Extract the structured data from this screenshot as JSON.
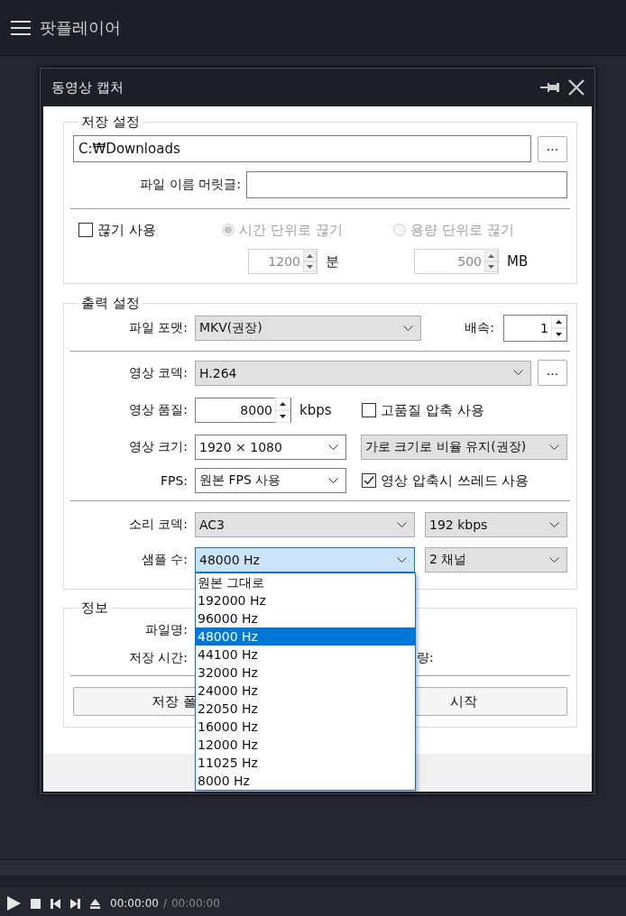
{
  "app": {
    "title": "팟플레이어"
  },
  "dialog": {
    "title": "동영상 캡처",
    "save": {
      "title": "저장 설정",
      "folder": "C:₩Downloads",
      "browse": "...",
      "prefix_label": "파일 이름 머릿글:",
      "split": {
        "label": "끊기 사용",
        "checked": false
      },
      "split_modes": [
        {
          "label": "시간 단위로 끊기",
          "selected": true,
          "disabled": true
        },
        {
          "label": "용량 단위로 끊기",
          "selected": false,
          "disabled": true
        }
      ],
      "spinners": [
        {
          "value": "1200",
          "unit": "분",
          "disabled": true
        },
        {
          "value": "500",
          "unit": "MB",
          "disabled": true
        }
      ]
    },
    "output": {
      "title": "출력 설정",
      "format": {
        "label": "파일 포맷:",
        "value": "MKV(권장)",
        "editable": false
      },
      "speed": {
        "label": "배속:",
        "value": "1"
      },
      "video_codec": {
        "label": "영상 코덱:",
        "value": "H.264",
        "editable": false,
        "button": "..."
      },
      "quality": {
        "label": "영상 품질:",
        "value": "8000",
        "unit": "kbps"
      },
      "high_quality": {
        "label": "고품질 압축 사용",
        "checked": false
      },
      "size": {
        "label": "영상 크기:",
        "value": "1920 × 1080",
        "editable": true
      },
      "aspect": {
        "value": "가로 크기로 비율 유지(권장)",
        "editable": false
      },
      "fps": {
        "label": "FPS:",
        "value": "원본 FPS 사용",
        "editable": true
      },
      "threads": {
        "label": "영상 압축시 쓰레드 사용",
        "checked": true
      },
      "audio_codec": {
        "label": "소리 코덱:",
        "value": "AC3",
        "editable": false
      },
      "bitrate": {
        "value": "192 kbps",
        "editable": false
      },
      "sample_rate": {
        "label": "샘플 수:",
        "value": "48000 Hz",
        "open": true
      },
      "channels": {
        "value": "2 채널",
        "editable": false
      },
      "sample_rate_options": [
        {
          "label": "원본 그대로",
          "selected": false
        },
        {
          "label": "192000 Hz",
          "selected": false
        },
        {
          "label": "96000 Hz",
          "selected": false
        },
        {
          "label": "48000 Hz",
          "selected": true
        },
        {
          "label": "44100 Hz",
          "selected": false
        },
        {
          "label": "32000 Hz",
          "selected": false
        },
        {
          "label": "24000 Hz",
          "selected": false
        },
        {
          "label": "22050 Hz",
          "selected": false
        },
        {
          "label": "16000 Hz",
          "selected": false
        },
        {
          "label": "12000 Hz",
          "selected": false
        },
        {
          "label": "11025 Hz",
          "selected": false
        },
        {
          "label": "8000 Hz",
          "selected": false
        }
      ]
    },
    "info": {
      "title": "정보",
      "file_label": "파일명:",
      "time_label": "저장 시간:",
      "size_label": "량:",
      "buttons": [
        "저장 폴",
        "시작"
      ]
    }
  },
  "player": {
    "current": "00:00:00",
    "separator": "/",
    "total": "00:00:00"
  }
}
